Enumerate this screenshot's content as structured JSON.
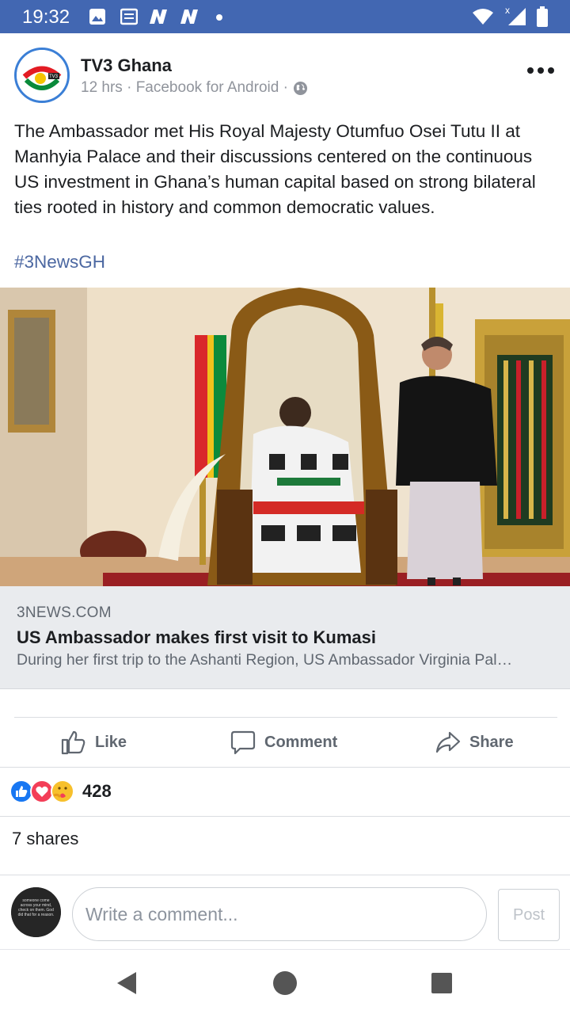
{
  "status_bar": {
    "time": "19:32",
    "background": "#4267b2"
  },
  "post": {
    "page_name": "TV3 Ghana",
    "avatar_text": "TV3",
    "meta": "12 hrs · Facebook for Android ·",
    "text": "The Ambassador met His Royal Majesty Otumfuo Osei Tutu II at Manhyia Palace and their discussions centered on the continuous US investment in Ghana’s human capital based on strong bilateral ties rooted in history and common democratic values.",
    "hashtag": "#3NewsGH"
  },
  "link_preview": {
    "source": "3NEWS.COM",
    "title": "US Ambassador makes first visit to Kumasi",
    "description": "During her first trip to the Ashanti Region, US Ambassador Virginia Pal…"
  },
  "actions": {
    "like": "Like",
    "comment": "Comment",
    "share": "Share"
  },
  "reactions": {
    "count": "428",
    "types": [
      "like-icon",
      "love-icon",
      "care-icon"
    ]
  },
  "shares_text": "7 shares",
  "composer": {
    "placeholder": "Write a comment...",
    "post_label": "Post",
    "avatar_text": "someone come across your mind, check on them. God did that for a reason."
  },
  "colors": {
    "brand": "#4267b2",
    "link": "#4b67a1",
    "muted": "#606770",
    "preview_bg": "#e9ebee"
  }
}
